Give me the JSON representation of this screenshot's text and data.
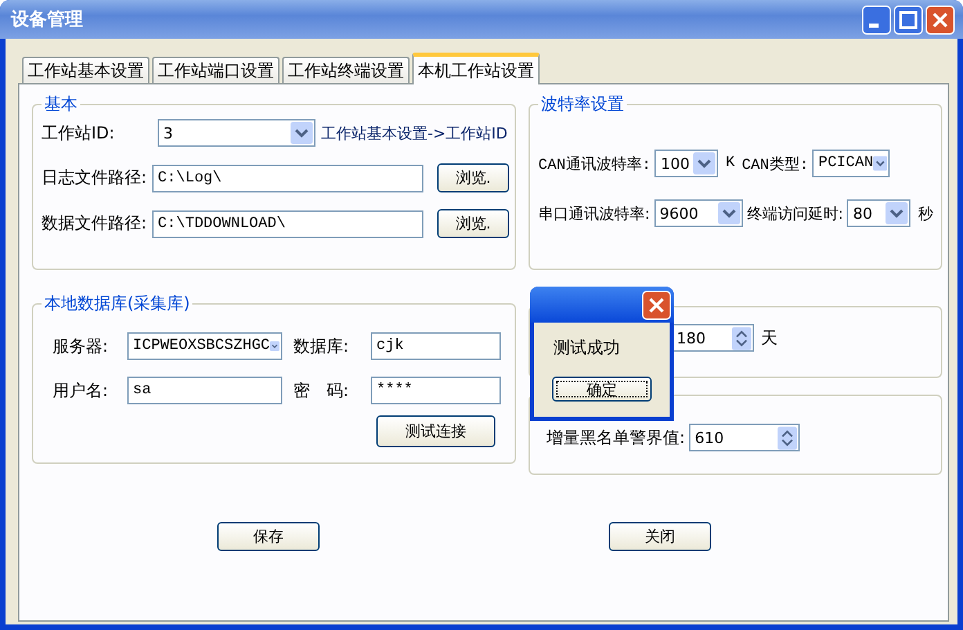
{
  "window": {
    "title": "设备管理"
  },
  "tabs": [
    {
      "label": "工作站基本设置",
      "selected": false
    },
    {
      "label": "工作站端口设置",
      "selected": false
    },
    {
      "label": "工作站终端设置",
      "selected": false
    },
    {
      "label": "本机工作站设置",
      "selected": true
    }
  ],
  "basic_group": {
    "title": "基本",
    "station_id": {
      "label": "工作站ID:",
      "value": "3",
      "hint": "工作站基本设置->工作站ID"
    },
    "log_path": {
      "label": "日志文件路径:",
      "value": "C:\\Log\\",
      "button": "浏览."
    },
    "data_path": {
      "label": "数据文件路径:",
      "value": "C:\\TDDOWNLOAD\\",
      "button": "浏览."
    }
  },
  "baud_group": {
    "title": "波特率设置",
    "can_rate": {
      "label": "CAN通讯波特率:",
      "value": "100",
      "unit": "K"
    },
    "can_type": {
      "label": "CAN类型:",
      "value": "PCICAN"
    },
    "serial_rate": {
      "label": "串口通讯波特率:",
      "value": "9600"
    },
    "delay": {
      "label": "终端访问延时:",
      "value": "80",
      "unit": "秒"
    }
  },
  "db_group": {
    "title": "本地数据库(采集库)",
    "server": {
      "label": "服务器:",
      "value": "ICPWEOXSBCSZHGC"
    },
    "database": {
      "label": "数据库:",
      "value": "cjk"
    },
    "user": {
      "label": "用户名:",
      "value": "sa"
    },
    "password": {
      "label": "密　码:",
      "value": "****"
    },
    "test_button": "测试连接"
  },
  "retention_group": {
    "value": "180",
    "unit": "天"
  },
  "blacklist_group": {
    "label": "增量黑名单警界值:",
    "value": "610"
  },
  "buttons": [
    "保存",
    "关闭"
  ],
  "dialog": {
    "message": "测试成功",
    "ok": "确定"
  }
}
